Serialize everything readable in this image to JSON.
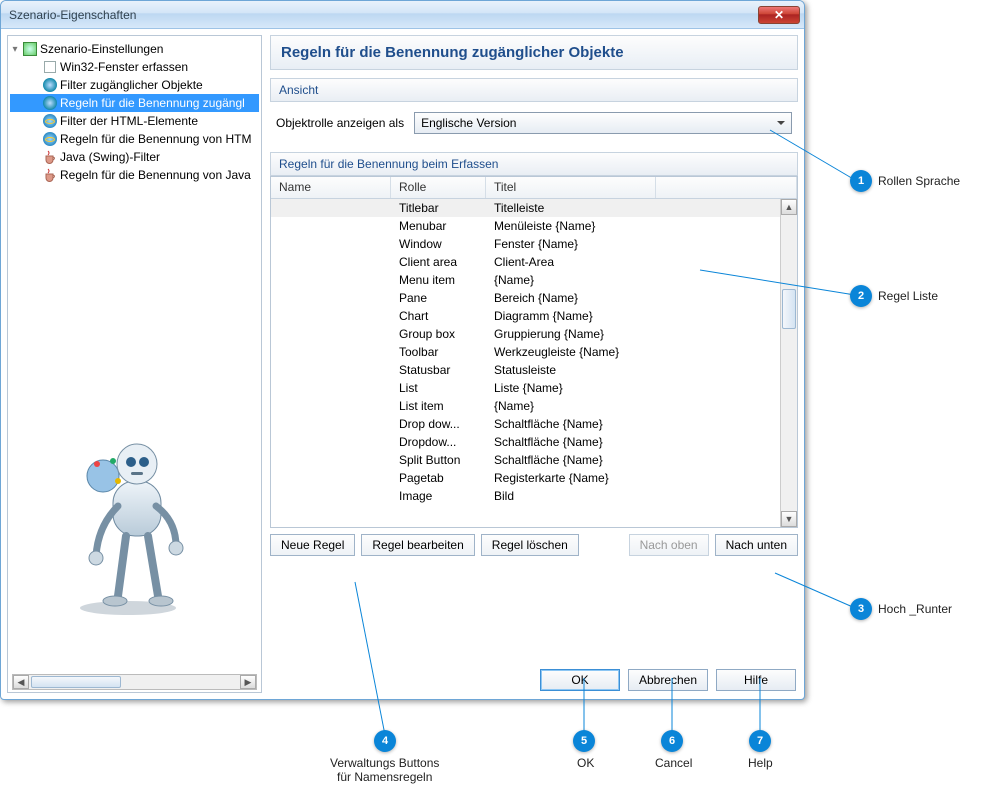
{
  "window": {
    "title": "Szenario-Eigenschaften"
  },
  "tree": {
    "root": "Szenario-Einstellungen",
    "items": [
      "Win32-Fenster erfassen",
      "Filter zugänglicher Objekte",
      "Regeln für die Benennung zugängl",
      "Filter der HTML-Elemente",
      "Regeln für die Benennung von HTM",
      "Java (Swing)-Filter",
      "Regeln für die Benennung von Java"
    ],
    "selected_index": 2
  },
  "page": {
    "title": "Regeln für die Benennung zugänglicher Objekte",
    "sections": {
      "view": "Ansicht",
      "rules": "Regeln für die Benennung beim Erfassen"
    },
    "view_label": "Objektrolle anzeigen als",
    "view_value": "Englische Version",
    "columns": {
      "name": "Name",
      "role": "Rolle",
      "title": "Titel"
    },
    "rows": [
      {
        "name": "",
        "role": "Titlebar",
        "title": "Titelleiste"
      },
      {
        "name": "",
        "role": "Menubar",
        "title": "Menüleiste {Name}"
      },
      {
        "name": "",
        "role": "Window",
        "title": "Fenster {Name}"
      },
      {
        "name": "",
        "role": "Client area",
        "title": "Client-Area"
      },
      {
        "name": "",
        "role": "Menu item",
        "title": "{Name}"
      },
      {
        "name": "",
        "role": "Pane",
        "title": "Bereich {Name}"
      },
      {
        "name": "",
        "role": "Chart",
        "title": "Diagramm {Name}"
      },
      {
        "name": "",
        "role": "Group box",
        "title": "Gruppierung {Name}"
      },
      {
        "name": "",
        "role": "Toolbar",
        "title": "Werkzeugleiste {Name}"
      },
      {
        "name": "",
        "role": "Statusbar",
        "title": "Statusleiste"
      },
      {
        "name": "",
        "role": "List",
        "title": "Liste {Name}"
      },
      {
        "name": "",
        "role": "List item",
        "title": "{Name}"
      },
      {
        "name": "",
        "role": "Drop dow...",
        "title": "Schaltfläche {Name}"
      },
      {
        "name": "",
        "role": "Dropdow...",
        "title": "Schaltfläche {Name}"
      },
      {
        "name": "",
        "role": "Split Button",
        "title": "Schaltfläche {Name}"
      },
      {
        "name": "",
        "role": "Pagetab",
        "title": "Registerkarte {Name}"
      },
      {
        "name": "",
        "role": "Image",
        "title": "Bild"
      }
    ],
    "buttons": {
      "new": "Neue Regel",
      "edit": "Regel bearbeiten",
      "delete": "Regel löschen",
      "up": "Nach oben",
      "down": "Nach unten"
    }
  },
  "footer": {
    "ok": "OK",
    "cancel": "Abbrechen",
    "help": "Hilfe"
  },
  "callouts": {
    "1": "Rollen Sprache",
    "2": "Regel Liste",
    "3": "Hoch _Runter",
    "4": "Verwaltungs Buttons\nfür Namensregeln",
    "5": "OK",
    "6": "Cancel",
    "7": "Help"
  }
}
